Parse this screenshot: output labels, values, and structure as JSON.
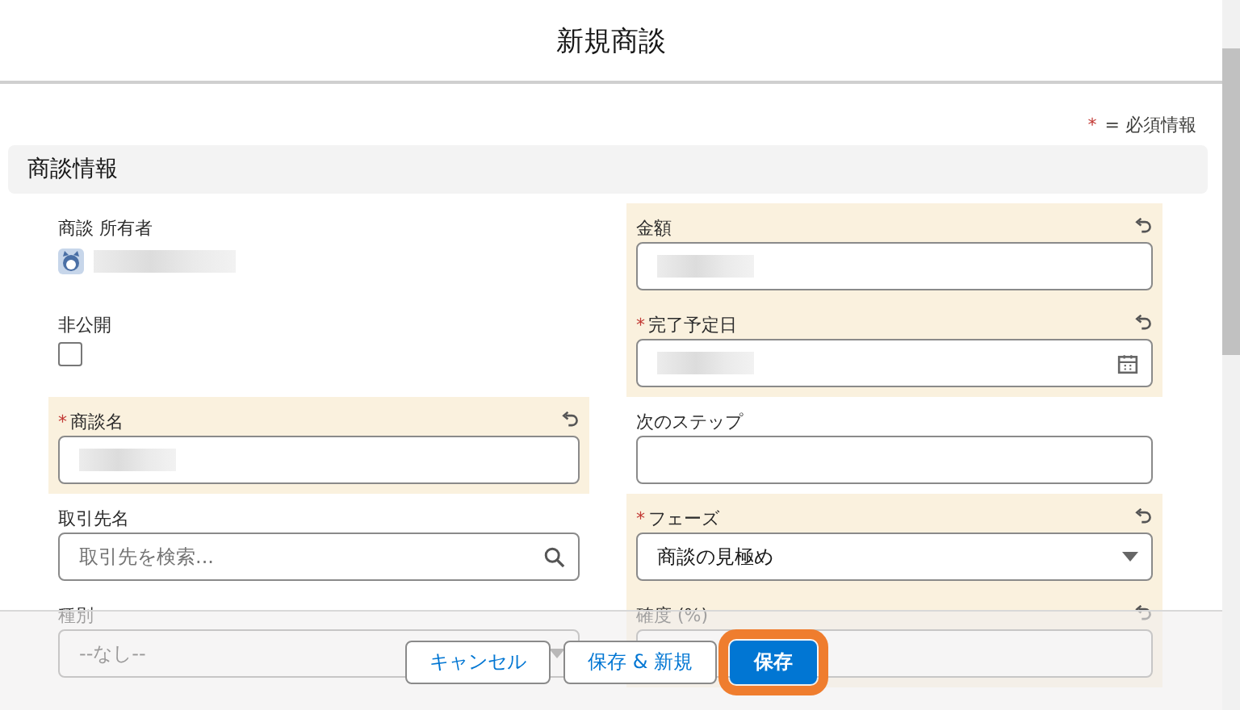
{
  "dialog": {
    "title": "新規商談"
  },
  "required_legend": {
    "mark": "*",
    "text": "= 必須情報"
  },
  "section": {
    "title": "商談情報"
  },
  "rows": [
    {
      "left": {
        "kind": "owner",
        "label": "商談 所有者",
        "required": false,
        "edited": false,
        "redacted": true
      },
      "right": {
        "kind": "text",
        "label": "金額",
        "required": false,
        "edited": true,
        "redacted": true
      }
    },
    {
      "left": {
        "kind": "checkbox",
        "label": "非公開",
        "required": false,
        "edited": false,
        "checked": false
      },
      "right": {
        "kind": "date",
        "label": "完了予定日",
        "required": true,
        "edited": true,
        "redacted": true
      }
    },
    {
      "left": {
        "kind": "text",
        "label": "商談名",
        "required": true,
        "edited": true,
        "redacted": true
      },
      "right": {
        "kind": "text",
        "label": "次のステップ",
        "required": false,
        "edited": false,
        "redacted": false
      }
    },
    {
      "left": {
        "kind": "lookup",
        "label": "取引先名",
        "required": false,
        "edited": false,
        "placeholder": "取引先を検索..."
      },
      "right": {
        "kind": "picklist",
        "label": "フェーズ",
        "required": true,
        "edited": true,
        "value": "商談の見極め"
      }
    },
    {
      "left": {
        "kind": "picklist",
        "label": "種別",
        "required": false,
        "edited": false,
        "value": "--なし--"
      },
      "right": {
        "kind": "text",
        "label": "確度 (%)",
        "required": false,
        "edited": true,
        "redacted": false
      }
    }
  ],
  "footer": {
    "buttons": [
      {
        "label": "キャンセル",
        "highlighted": false
      },
      {
        "label": "保存 & 新規",
        "highlighted": false
      },
      {
        "label": "保存",
        "highlighted": true
      }
    ]
  }
}
